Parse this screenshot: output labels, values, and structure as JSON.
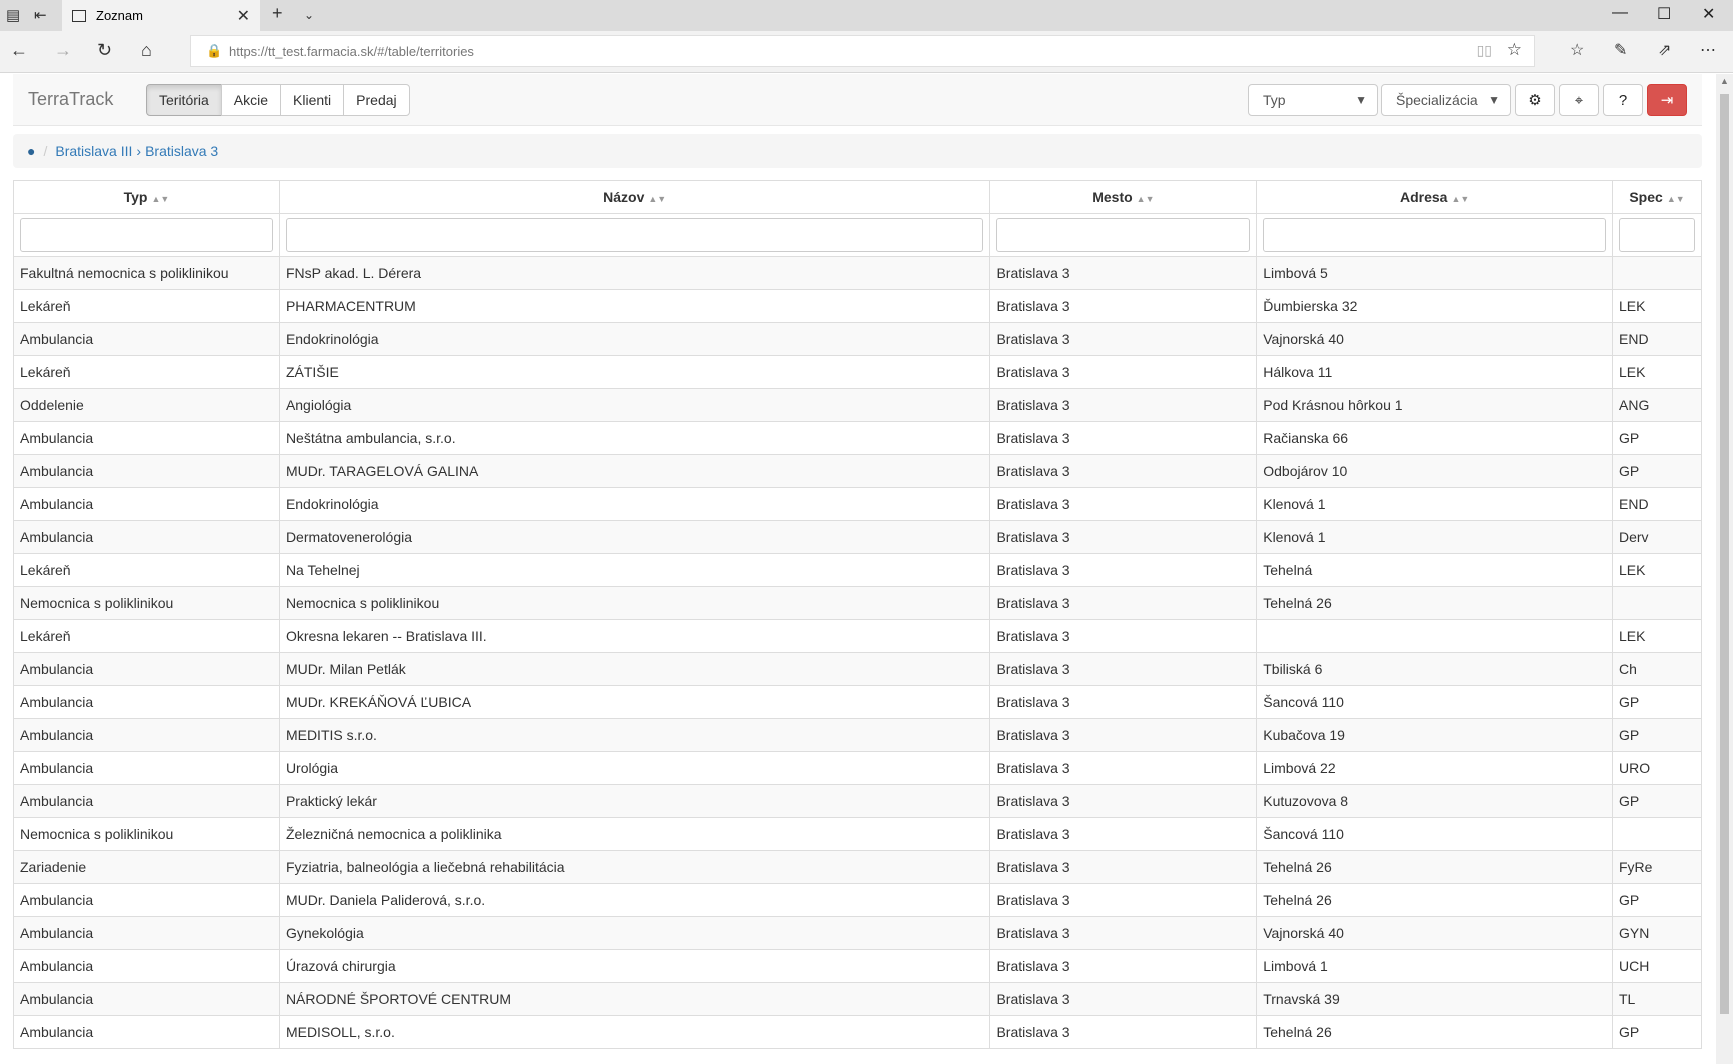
{
  "browser": {
    "tab_title": "Zoznam",
    "url": "https://tt_test.farmacia.sk/#/table/territories"
  },
  "app": {
    "brand": "TerraTrack",
    "nav": [
      {
        "label": "Teritória",
        "active": true
      },
      {
        "label": "Akcie",
        "active": false
      },
      {
        "label": "Klienti",
        "active": false
      },
      {
        "label": "Predaj",
        "active": false
      }
    ],
    "type_select": "Typ",
    "spec_select": "Špecializácia",
    "icons": [
      "gear-icon",
      "map-marker-icon",
      "help-icon",
      "logout-icon"
    ],
    "danger_color": "#d9534f"
  },
  "breadcrumb": {
    "items": [
      "Bratislava III",
      "Bratislava 3"
    ]
  },
  "table": {
    "headers": [
      "Typ",
      "Názov",
      "Mesto",
      "Adresa",
      "Spec"
    ],
    "rows": [
      [
        "Fakultná nemocnica s poliklinikou",
        "FNsP akad. L. Dérera",
        "Bratislava 3",
        "Limbová 5",
        ""
      ],
      [
        "Lekáreň",
        "PHARMACENTRUM",
        "Bratislava 3",
        "Ďumbierska 32",
        "LEK"
      ],
      [
        "Ambulancia",
        "Endokrinológia",
        "Bratislava 3",
        "Vajnorská 40",
        "END"
      ],
      [
        "Lekáreň",
        "ZÁTIŠIE",
        "Bratislava 3",
        "Hálkova 11",
        "LEK"
      ],
      [
        "Oddelenie",
        "Angiológia",
        "Bratislava 3",
        "Pod Krásnou hôrkou 1",
        "ANG"
      ],
      [
        "Ambulancia",
        "Neštátna ambulancia, s.r.o.",
        "Bratislava 3",
        "Račianska 66",
        "GP"
      ],
      [
        "Ambulancia",
        "MUDr. TARAGELOVÁ GALINA",
        "Bratislava 3",
        "Odbojárov 10",
        "GP"
      ],
      [
        "Ambulancia",
        "Endokrinológia",
        "Bratislava 3",
        "Klenová 1",
        "END"
      ],
      [
        "Ambulancia",
        "Dermatovenerológia",
        "Bratislava 3",
        "Klenová 1",
        "Derv"
      ],
      [
        "Lekáreň",
        "Na Tehelnej",
        "Bratislava 3",
        "Tehelná",
        "LEK"
      ],
      [
        "Nemocnica s poliklinikou",
        "Nemocnica s poliklinikou",
        "Bratislava 3",
        "Tehelná 26",
        ""
      ],
      [
        "Lekáreň",
        "Okresna lekaren -- Bratislava III.",
        "Bratislava 3",
        "",
        "LEK"
      ],
      [
        "Ambulancia",
        "MUDr. Milan Petlák",
        "Bratislava 3",
        "Tbiliská 6",
        "Ch"
      ],
      [
        "Ambulancia",
        "MUDr. KREKÁŇOVÁ ĽUBICA",
        "Bratislava 3",
        "Šancová 110",
        "GP"
      ],
      [
        "Ambulancia",
        "MEDITIS s.r.o.",
        "Bratislava 3",
        "Kubačova 19",
        "GP"
      ],
      [
        "Ambulancia",
        "Urológia",
        "Bratislava 3",
        "Limbová 22",
        "URO"
      ],
      [
        "Ambulancia",
        "Praktický lekár",
        "Bratislava 3",
        "Kutuzovova 8",
        "GP"
      ],
      [
        "Nemocnica s poliklinikou",
        "Železničná nemocnica a poliklinika",
        "Bratislava 3",
        "Šancová 110",
        ""
      ],
      [
        "Zariadenie",
        "Fyziatria, balneológia a liečebná rehabilitácia",
        "Bratislava 3",
        "Tehelná 26",
        "FyRe"
      ],
      [
        "Ambulancia",
        "MUDr. Daniela Paliderová, s.r.o.",
        "Bratislava 3",
        "Tehelná 26",
        "GP"
      ],
      [
        "Ambulancia",
        "Gynekológia",
        "Bratislava 3",
        "Vajnorská 40",
        "GYN"
      ],
      [
        "Ambulancia",
        "Úrazová chirurgia",
        "Bratislava 3",
        "Limbová 1",
        "UCH"
      ],
      [
        "Ambulancia",
        "NÁRODNÉ ŠPORTOVÉ CENTRUM",
        "Bratislava 3",
        "Trnavská 39",
        "TL"
      ],
      [
        "Ambulancia",
        "MEDISOLL, s.r.o.",
        "Bratislava 3",
        "Tehelná 26",
        "GP"
      ]
    ]
  }
}
